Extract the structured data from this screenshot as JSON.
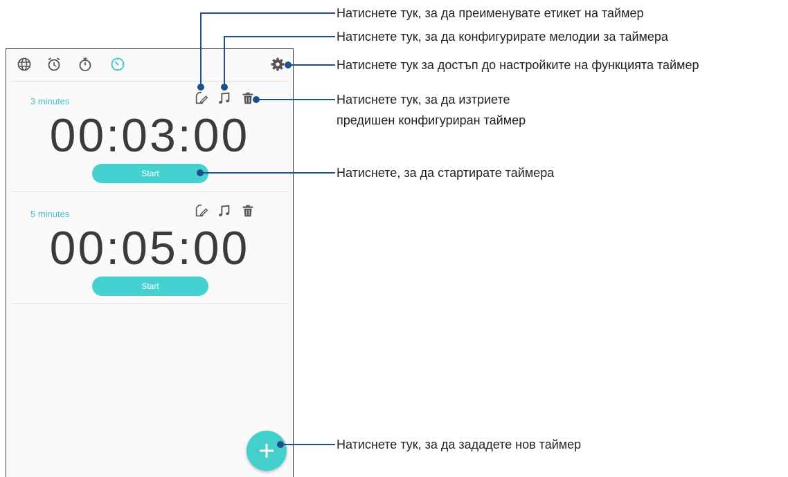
{
  "app": {
    "tabs": [
      {
        "name": "world-clock",
        "icon": "globe-icon"
      },
      {
        "name": "alarm",
        "icon": "alarm-clock-icon"
      },
      {
        "name": "stopwatch",
        "icon": "stopwatch-icon"
      },
      {
        "name": "timer",
        "icon": "timer-icon",
        "active": true
      }
    ],
    "settings_icon": "gear-icon",
    "accent_color": "#45d1d0",
    "timers": [
      {
        "label": "3 minutes",
        "time": "00:03:00",
        "start_label": "Start"
      },
      {
        "label": "5 minutes",
        "time": "00:05:00",
        "start_label": "Start"
      }
    ],
    "fab_icon": "plus-icon"
  },
  "callouts": {
    "rename": "Натиснете тук, за да преименувате етикет на таймер",
    "ringtone": "Натиснете тук, за да конфигурирате мелодии за таймера",
    "settings": "Натиснете тук за достъп до настройките на функцията таймер",
    "delete_line1": "Натиснете тук, за да изтриете",
    "delete_line2": "предишен конфигуриран таймер",
    "start": "Натиснете, за да стартирате таймера",
    "add": "Натиснете тук, за да зададете нов таймер"
  }
}
